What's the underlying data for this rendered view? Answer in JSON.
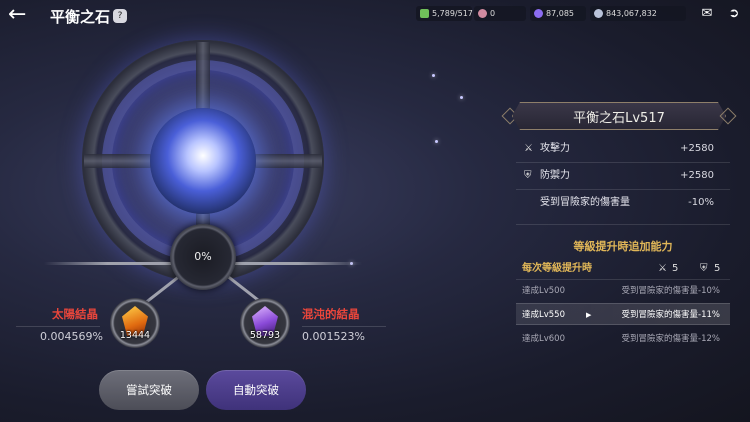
{
  "header": {
    "back_icon": "back-arrow-icon",
    "title": "平衡之石",
    "help_icon": "help-icon"
  },
  "resources": [
    {
      "icon": "crystal-green-icon",
      "value": "5,789/517",
      "color": "#6fbf5a"
    },
    {
      "icon": "orb-pink-icon",
      "value": "0",
      "color": "#d08aa0"
    },
    {
      "icon": "gem-purple-icon",
      "value": "87,085",
      "color": "#8b6cf0"
    },
    {
      "icon": "coin-silver-icon",
      "value": "843,067,832",
      "color": "#b8c2d8"
    }
  ],
  "top_icons": [
    "mail-icon",
    "exit-icon"
  ],
  "stone": {
    "progress": "0%",
    "sun_crystal": {
      "label": "太陽結晶",
      "count": "13444",
      "rate": "0.004569%",
      "color": "#f0a020"
    },
    "chaos_crystal": {
      "label": "混沌的結晶",
      "count": "58793",
      "rate": "0.001523%",
      "color": "#9a5ee0"
    }
  },
  "buttons": {
    "try": "嘗試突破",
    "auto": "自動突破"
  },
  "panel": {
    "title": "平衡之石Lv517",
    "stats": [
      {
        "icon": "sword-icon",
        "label": "攻擊力",
        "value": "+2580"
      },
      {
        "icon": "shield-icon",
        "label": "防禦力",
        "value": "+2580"
      },
      {
        "icon": "",
        "label": "受到冒險家的傷害量",
        "value": "-10%"
      }
    ],
    "levelup_title": "等級提升時追加能力",
    "per_level": {
      "label": "每次等級提升時",
      "atk": "5",
      "def": "5"
    },
    "milestones": [
      {
        "label": "達成Lv500",
        "value": "受到冒險家的傷害量-10%",
        "active": false
      },
      {
        "label": "達成Lv550",
        "value": "受到冒險家的傷害量-11%",
        "active": true
      },
      {
        "label": "達成Lv600",
        "value": "受到冒險家的傷害量-12%",
        "active": false
      }
    ]
  }
}
